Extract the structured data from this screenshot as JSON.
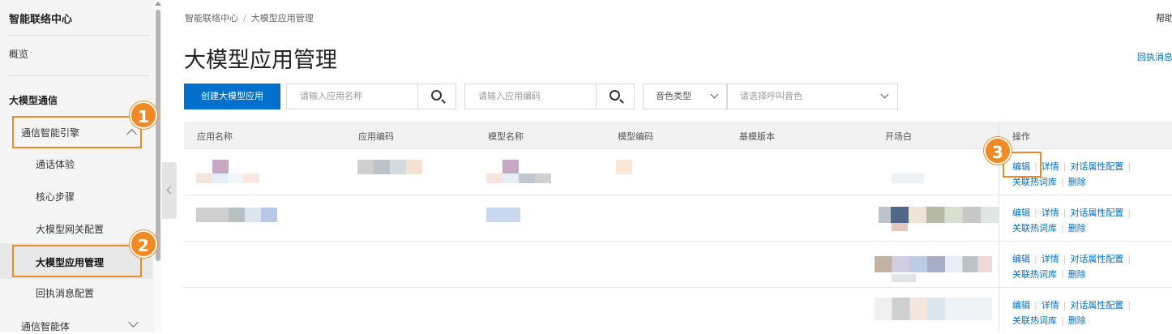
{
  "sidebar": {
    "title": "智能联络中心",
    "overview": "概览",
    "section": "大模型通信",
    "group": "通信智能引擎",
    "sub_items": [
      "通话体验",
      "核心步骤",
      "大模型网关配置",
      "大模型应用管理",
      "回执消息配置"
    ],
    "bottom_group": "通信智能体"
  },
  "breadcrumb": {
    "root": "智能联络中心",
    "current": "大模型应用管理"
  },
  "header": {
    "help": "帮助",
    "title": "大模型应用管理",
    "top_link": "回执消息"
  },
  "toolbar": {
    "create_label": "创建大模型应用",
    "name_placeholder": "请输入应用名称",
    "code_placeholder": "请输入应用编码",
    "voice_type": "音色类型",
    "voice_placeholder": "请选择呼叫音色"
  },
  "table": {
    "headers": [
      "应用名称",
      "应用编码",
      "模型名称",
      "模型编码",
      "基模版本",
      "开场白",
      "操作"
    ],
    "actions": {
      "edit": "编辑",
      "detail": "详情",
      "dialog": "对话属性配置",
      "hotword": "关联热词库",
      "delete": "删除"
    }
  },
  "markers": [
    "1",
    "2",
    "3"
  ],
  "colors": {
    "accent": "#0070cc",
    "marker": "#f08a24"
  }
}
